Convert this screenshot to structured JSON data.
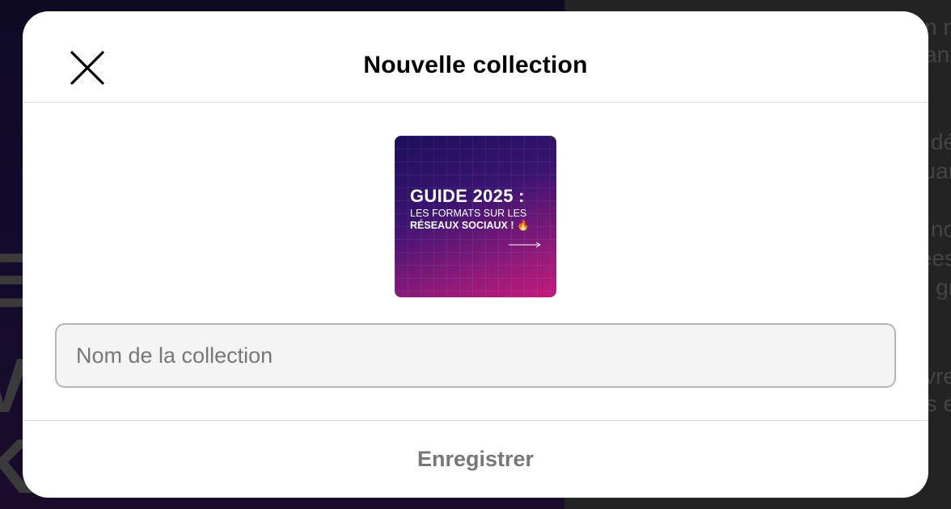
{
  "modal": {
    "title": "Nouvelle collection",
    "close_icon": "close-icon",
    "thumbnail": {
      "line1": "GUIDE 2025 :",
      "line2": "LES FORMATS SUR LES",
      "line3": "RÉSEAUX SOCIAUX ! 🔥",
      "arrow_icon": "arrow-right-icon"
    },
    "input": {
      "placeholder": "Nom de la collection",
      "value": ""
    },
    "save_label": "Enregistrer"
  },
  "colors": {
    "title": "#000000",
    "save_disabled": "#777777",
    "input_bg": "#f4f4f4",
    "input_border": "#b5b5b5"
  }
}
